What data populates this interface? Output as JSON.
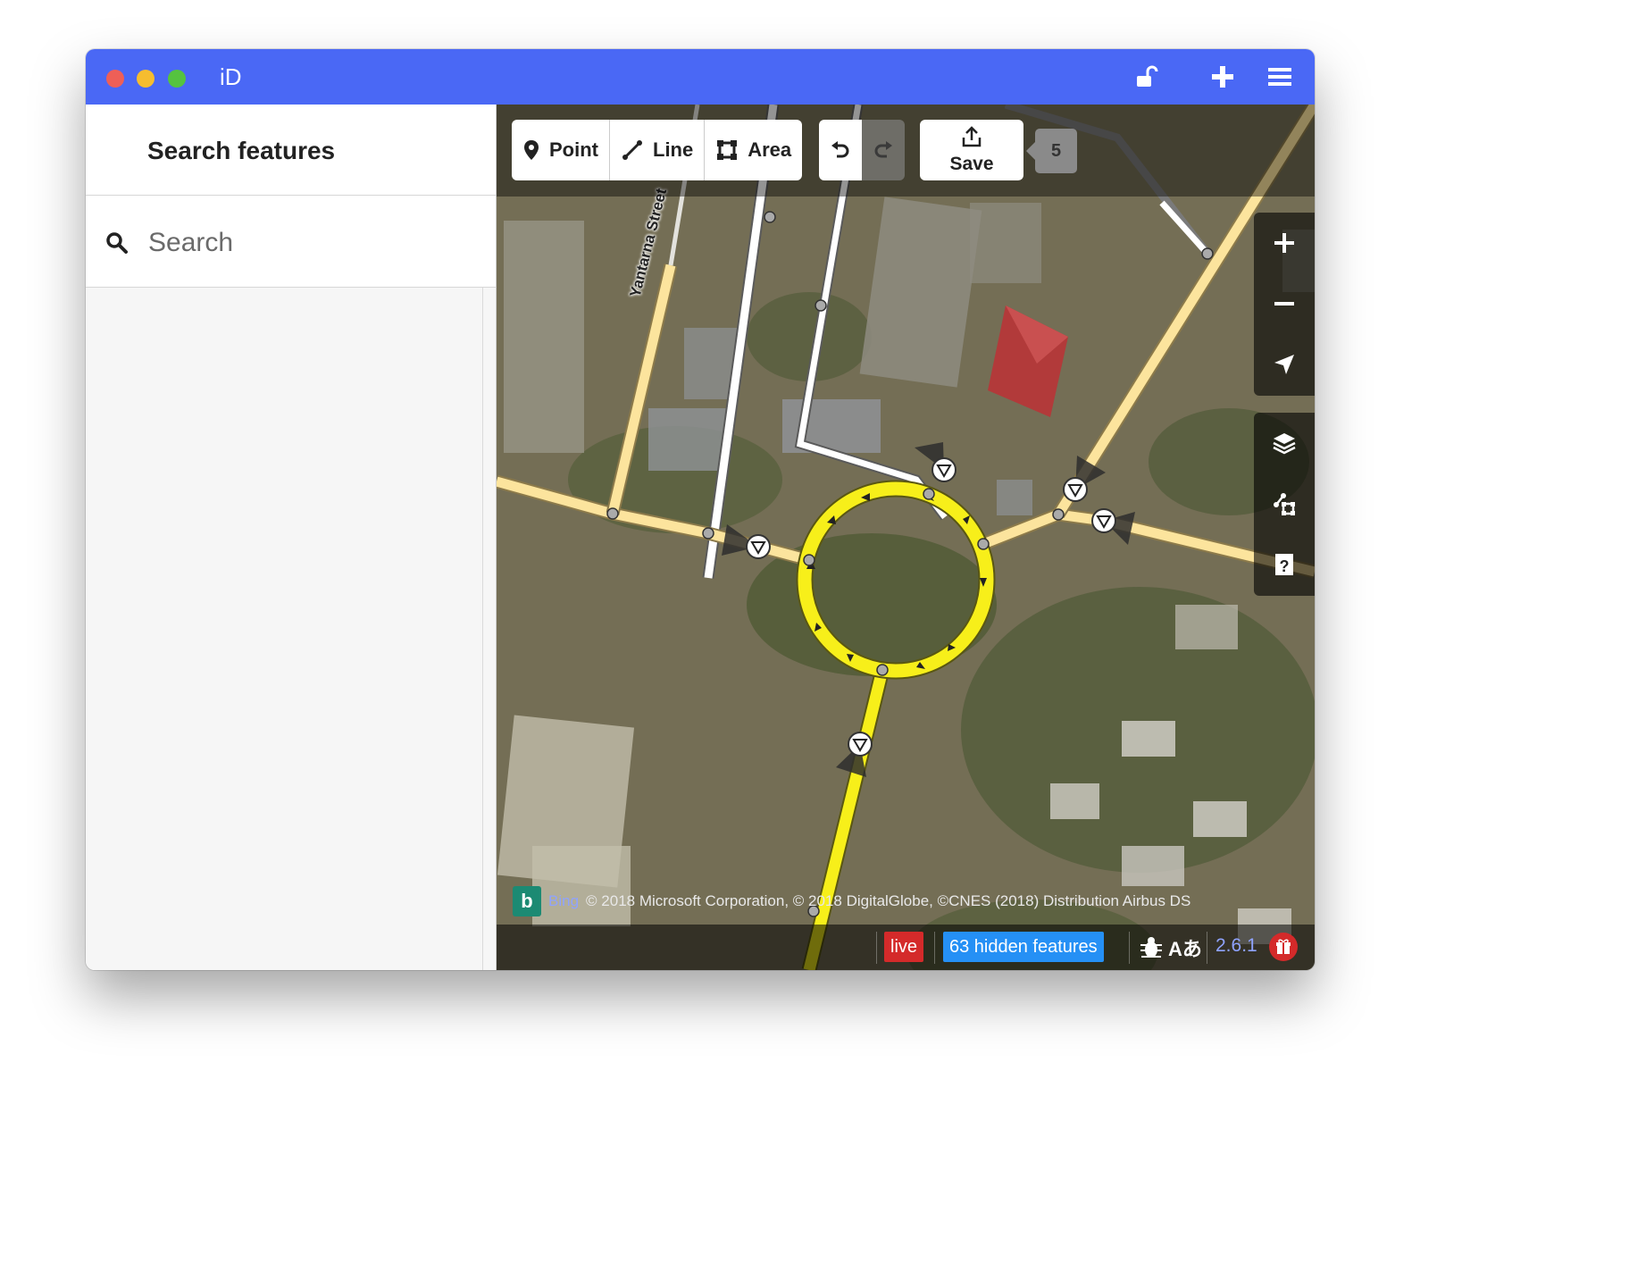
{
  "window": {
    "title": "iD",
    "traffic_colors": {
      "close": "#ee5f57",
      "minimize": "#f6bd2f",
      "maximize": "#55c33f"
    },
    "titlebar_color": "#4a68f5"
  },
  "sidebar": {
    "header_title": "Search features",
    "search_placeholder": "Search"
  },
  "toolbar": {
    "modes": [
      {
        "label": "Point",
        "icon": "pin-icon"
      },
      {
        "label": "Line",
        "icon": "line-icon"
      },
      {
        "label": "Area",
        "icon": "area-icon"
      }
    ],
    "save_label": "Save",
    "edit_count": "5"
  },
  "map": {
    "street_label": "Yantarna Street",
    "attribution_brand": "Bing",
    "attribution_text": "© 2018 Microsoft Corporation, © 2018 DigitalGlobe, ©CNES (2018) Distribution Airbus DS",
    "road_colors": {
      "residential": "#fce49d",
      "primary": "#f7ef1a",
      "service": "#ffffff"
    }
  },
  "map_controls": {
    "zoom": [
      "zoom-in",
      "zoom-out",
      "geolocate"
    ],
    "panels": [
      "layers",
      "map-data",
      "help"
    ]
  },
  "footer": {
    "live_label": "live",
    "hidden_features": "63 hidden features",
    "lang_label": "Aあ",
    "version": "2.6.1"
  }
}
